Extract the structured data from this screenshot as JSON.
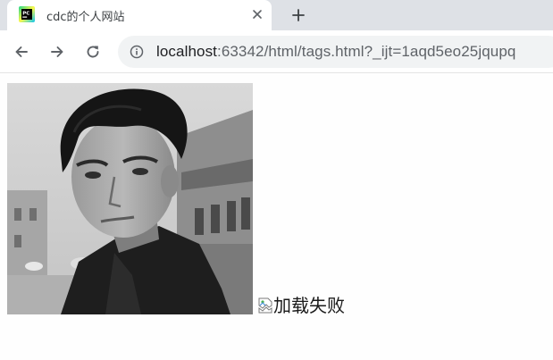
{
  "tab": {
    "title": "cdc的个人网站",
    "favicon": "pycharm-icon"
  },
  "toolbar": {
    "url_host": "localhost",
    "url_rest": ":63342/html/tags.html?_ijt=1aqd5eo25jqupq",
    "icons": [
      "back-arrow-icon",
      "forward-arrow-icon",
      "reload-icon",
      "info-icon"
    ]
  },
  "page": {
    "image_1": {
      "description_icon": "portrait-photo"
    },
    "image_2": {
      "alt_text": "加载失败",
      "icon": "broken-image-icon"
    }
  }
}
